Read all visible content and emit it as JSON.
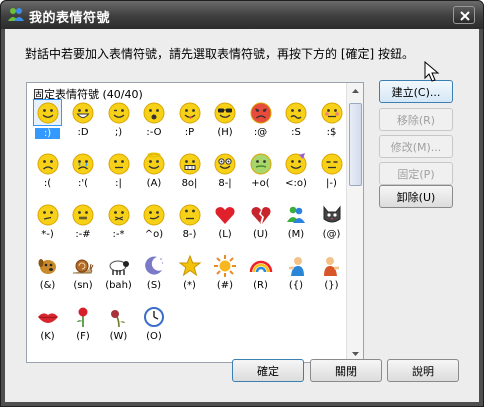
{
  "window": {
    "title": "我的表情符號",
    "instruction": "對話中若要加入表情符號，請先選取表情符號，再按下方的 [確定] 按鈕。"
  },
  "emoticons": {
    "label": "固定表情符號 (40/40)",
    "items": [
      {
        "code": ":)",
        "icon": "smile-icon"
      },
      {
        "code": ":D",
        "icon": "big-grin-icon"
      },
      {
        "code": ";)",
        "icon": "wink-icon"
      },
      {
        "code": ":-O",
        "icon": "surprised-icon"
      },
      {
        "code": ":P",
        "icon": "tongue-out-icon"
      },
      {
        "code": "(H)",
        "icon": "sunglasses-icon"
      },
      {
        "code": ":@",
        "icon": "angry-icon"
      },
      {
        "code": ":S",
        "icon": "confused-icon"
      },
      {
        "code": ":$",
        "icon": "embarrassed-icon"
      },
      {
        "code": ":(",
        "icon": "sad-icon"
      },
      {
        "code": ":'(",
        "icon": "crying-icon"
      },
      {
        "code": ":|",
        "icon": "disappointed-icon"
      },
      {
        "code": "(A)",
        "icon": "angel-icon"
      },
      {
        "code": "8o|",
        "icon": "baring-teeth-icon"
      },
      {
        "code": "8-|",
        "icon": "nerd-icon"
      },
      {
        "code": "+o(",
        "icon": "sick-icon"
      },
      {
        "code": "<:o)",
        "icon": "party-icon"
      },
      {
        "code": "|-)",
        "icon": "sleepy-icon"
      },
      {
        "code": "*-)",
        "icon": "thinking-icon"
      },
      {
        "code": ":-#",
        "icon": "dont-tell-icon"
      },
      {
        "code": ":-*",
        "icon": "secret-icon"
      },
      {
        "code": "^o)",
        "icon": "sarcastic-icon"
      },
      {
        "code": "8-)",
        "icon": "eye-rolling-icon"
      },
      {
        "code": "(L)",
        "icon": "red-heart-icon"
      },
      {
        "code": "(U)",
        "icon": "broken-heart-icon"
      },
      {
        "code": "(M)",
        "icon": "messenger-icon"
      },
      {
        "code": "(@)",
        "icon": "cat-face-icon"
      },
      {
        "code": "(&)",
        "icon": "dog-face-icon"
      },
      {
        "code": "(sn)",
        "icon": "snail-icon"
      },
      {
        "code": "(bah)",
        "icon": "black-sheep-icon"
      },
      {
        "code": "(S)",
        "icon": "moon-icon"
      },
      {
        "code": "(*)",
        "icon": "star-icon"
      },
      {
        "code": "(#)",
        "icon": "sun-icon"
      },
      {
        "code": "(R)",
        "icon": "rainbow-icon"
      },
      {
        "code": "({)",
        "icon": "left-hug-icon"
      },
      {
        "code": "(})",
        "icon": "right-hug-icon"
      },
      {
        "code": "(K)",
        "icon": "red-lips-icon"
      },
      {
        "code": "(F)",
        "icon": "red-rose-icon"
      },
      {
        "code": "(W)",
        "icon": "wilted-rose-icon"
      },
      {
        "code": "(O)",
        "icon": "clock-icon"
      }
    ]
  },
  "side_buttons": {
    "create": "建立(C)...",
    "rename": "移除(R)",
    "edit": "修改(M)...",
    "pin": "固定(P)",
    "delete": "卸除(U)"
  },
  "bottom_buttons": {
    "ok": "確定",
    "close": "關閉",
    "help": "說明"
  },
  "colors": {
    "titlebar": "#3e3e3e",
    "selection": "#3399ff",
    "smiley_yellow": "#f7d117"
  }
}
